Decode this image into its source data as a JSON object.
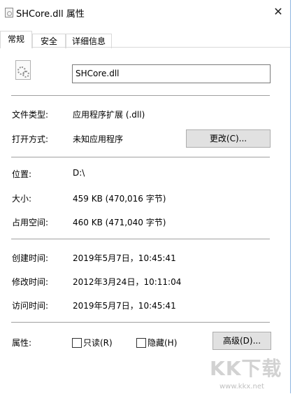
{
  "window": {
    "title": "SHCore.dll 属性",
    "close_glyph": "✕"
  },
  "tabs": [
    {
      "label": "常规",
      "active": true
    },
    {
      "label": "安全",
      "active": false
    },
    {
      "label": "详细信息",
      "active": false
    }
  ],
  "general": {
    "file_name": "SHCore.dll",
    "file_type": {
      "label": "文件类型:",
      "value": "应用程序扩展 (.dll)"
    },
    "opens_with": {
      "label": "打开方式:",
      "value": "未知应用程序",
      "button": "更改(C)..."
    },
    "location": {
      "label": "位置:",
      "value": "D:\\"
    },
    "size": {
      "label": "大小:",
      "value": "459 KB (470,016 字节)"
    },
    "size_on_disk": {
      "label": "占用空间:",
      "value": "460 KB (471,040 字节)"
    },
    "created": {
      "label": "创建时间:",
      "value": "2019年5月7日，10:45:41"
    },
    "modified": {
      "label": "修改时间:",
      "value": "2012年3月24日，10:11:04"
    },
    "accessed": {
      "label": "访问时间:",
      "value": "2019年5月7日，10:45:41"
    },
    "attributes": {
      "label": "属性:",
      "readonly": {
        "label": "只读(R)",
        "checked": false
      },
      "hidden": {
        "label": "隐藏(H)",
        "checked": false
      },
      "advanced_button": "高级(D)..."
    }
  },
  "watermark": {
    "logo": "KK下载",
    "url": "www.kkx.net"
  }
}
